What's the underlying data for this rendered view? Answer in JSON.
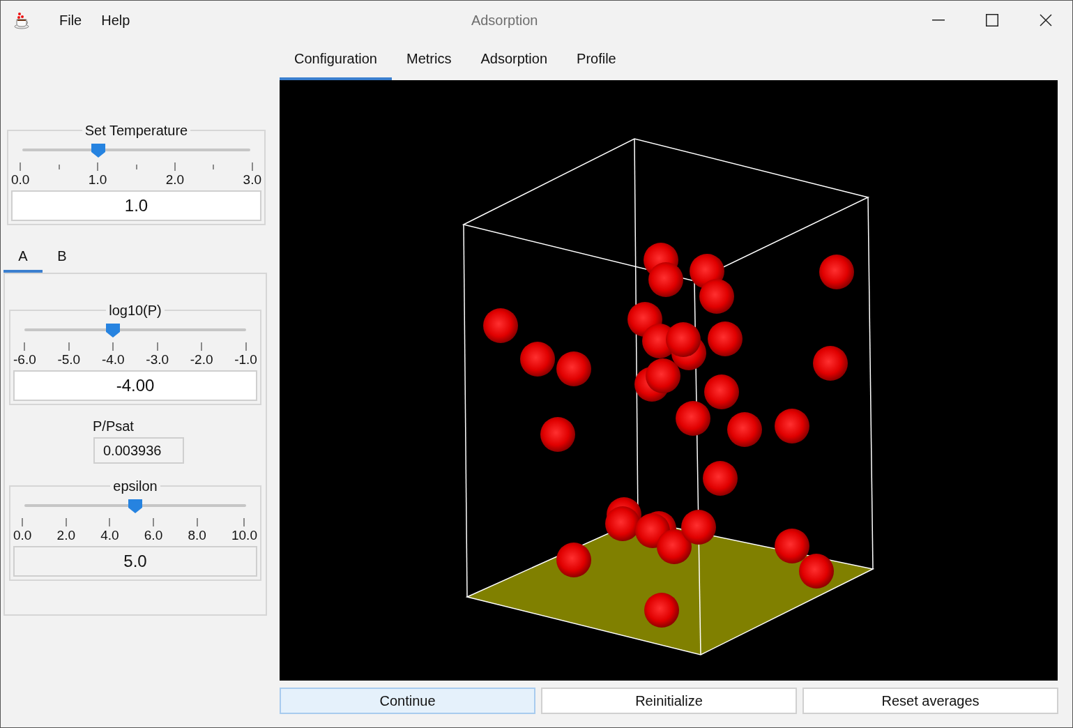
{
  "window": {
    "title": "Adsorption",
    "menu": [
      "File",
      "Help"
    ]
  },
  "main_tabs": [
    {
      "label": "Configuration",
      "selected": true
    },
    {
      "label": "Metrics",
      "selected": false
    },
    {
      "label": "Adsorption",
      "selected": false
    },
    {
      "label": "Profile",
      "selected": false
    }
  ],
  "left_panel": {
    "temperature": {
      "title": "Set Temperature",
      "level": 0.333,
      "ticks": [
        "0.0",
        "1.0",
        "2.0",
        "3.0"
      ],
      "minor_ticks": true,
      "value": "1.0",
      "disabled": false
    },
    "species_tabs": [
      {
        "label": "A",
        "selected": true
      },
      {
        "label": "B",
        "selected": false
      }
    ],
    "pressure": {
      "title": "log10(P)",
      "level": 0.4,
      "ticks": [
        "-6.0",
        "-5.0",
        "-4.0",
        "-3.0",
        "-2.0",
        "-1.0"
      ],
      "minor_ticks": false,
      "value": "-4.00",
      "disabled": false
    },
    "p_psat": {
      "label": "P/Psat",
      "value": "0.003936"
    },
    "epsilon": {
      "title": "epsilon",
      "level": 0.5,
      "ticks": [
        "0.0",
        "2.0",
        "4.0",
        "6.0",
        "8.0",
        "10.0"
      ],
      "minor_ticks": false,
      "value": "5.0",
      "disabled": true
    }
  },
  "buttons": [
    {
      "label": "Continue",
      "default": true
    },
    {
      "label": "Reinitialize",
      "default": false
    },
    {
      "label": "Reset averages",
      "default": false
    }
  ]
}
